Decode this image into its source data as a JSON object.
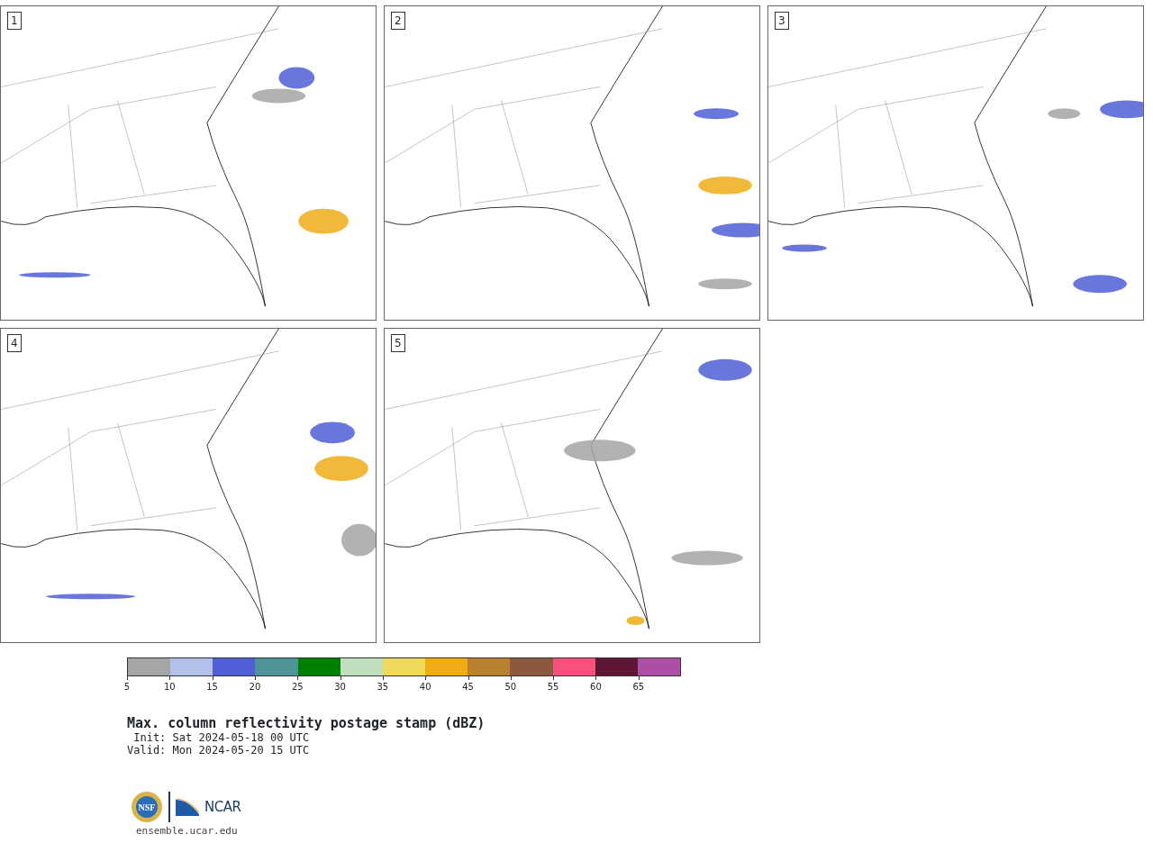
{
  "panels": [
    {
      "label": "1"
    },
    {
      "label": "2"
    },
    {
      "label": "3"
    },
    {
      "label": "4"
    },
    {
      "label": "5"
    }
  ],
  "colorbar": {
    "bins": [
      {
        "label": "5",
        "color": "#a5a5a5"
      },
      {
        "label": "10",
        "color": "#b4c0ec"
      },
      {
        "label": "15",
        "color": "#4f5fd6"
      },
      {
        "label": "20",
        "color": "#4f9598"
      },
      {
        "label": "25",
        "color": "#008000"
      },
      {
        "label": "30",
        "color": "#bfdfbf"
      },
      {
        "label": "35",
        "color": "#efd85c"
      },
      {
        "label": "40",
        "color": "#f0ac17"
      },
      {
        "label": "45",
        "color": "#b8802f"
      },
      {
        "label": "50",
        "color": "#8b5a3e"
      },
      {
        "label": "55",
        "color": "#f4517c"
      },
      {
        "label": "60",
        "color": "#5f1634"
      },
      {
        "label": "65",
        "color": "#ad4fa5"
      }
    ]
  },
  "title": "Max. column reflectivity postage stamp (dBZ)",
  "init": " Init: Sat 2024-05-18 00 UTC",
  "valid": "Valid: Mon 2024-05-20 15 UTC",
  "logo": {
    "nsf": "NSF",
    "ncar": "NCAR"
  },
  "url": "ensemble.ucar.edu"
}
